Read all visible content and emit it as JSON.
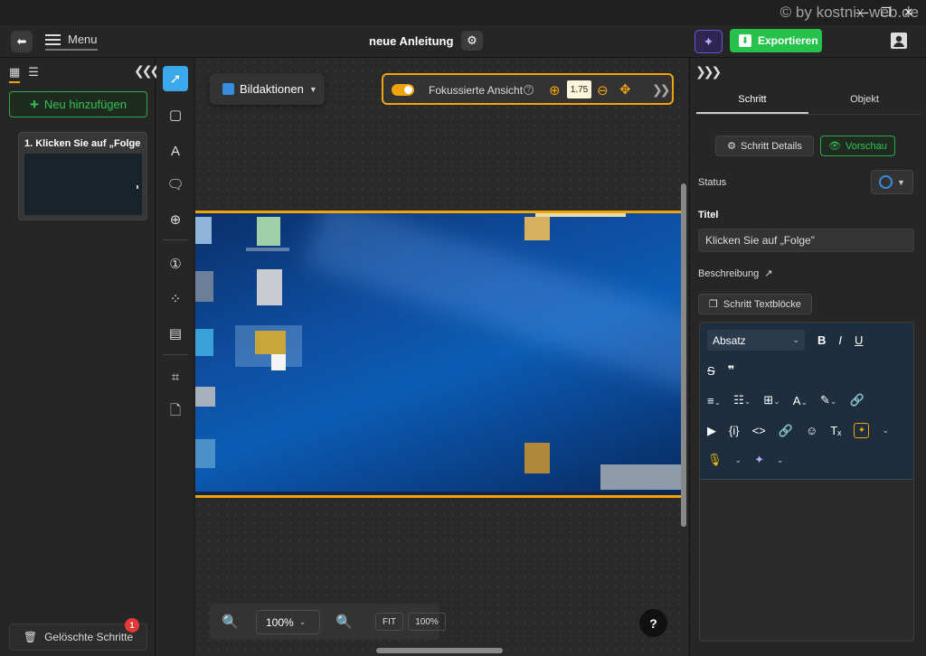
{
  "window": {
    "watermark": "© by kostnix-web.de"
  },
  "header": {
    "menu_label": "Menu",
    "title": "neue Anleitung",
    "export_label": "Exportieren"
  },
  "steps_panel": {
    "add_label": "Neu hinzufügen",
    "steps": [
      {
        "title": "1. Klicken Sie auf „Folge ..."
      }
    ],
    "deleted_label": "Gelöschte Schritte",
    "deleted_count": "1"
  },
  "canvas": {
    "image_actions_label": "Bildaktionen",
    "focus_label": "Fokussierte Ansicht",
    "focus_enabled": true,
    "focus_zoom": "1.75",
    "zoom_level": "100%",
    "fit_label": "FIT",
    "reset_label": "100%",
    "help_label": "?"
  },
  "right_panel": {
    "tabs": [
      {
        "label": "Schritt"
      },
      {
        "label": "Objekt"
      }
    ],
    "active_tab": "Schritt",
    "details_label": "Schritt Details",
    "preview_label": "Vorschau",
    "status_label": "Status",
    "title_label": "Titel",
    "title_value": "Klicken Sie auf „Folge\"",
    "description_label": "Beschreibung",
    "textblocks_label": "Schritt Textblöcke",
    "paragraph_style": "Absatz"
  },
  "colors": {
    "accent": "#f0a30a",
    "primary_green": "#27c24c",
    "selected_tool": "#3aa8ea",
    "status_ring": "#3a8dde",
    "badge": "#e53935"
  }
}
